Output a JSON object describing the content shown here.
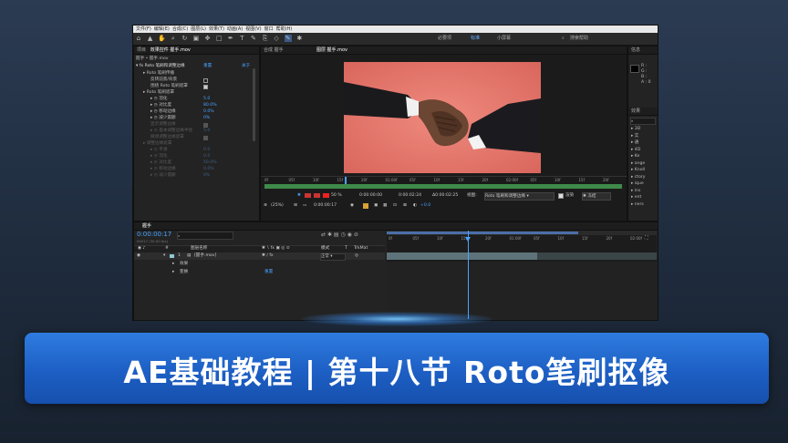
{
  "menu": [
    "文件(F)",
    "编辑(E)",
    "合成(C)",
    "图层(L)",
    "效果(T)",
    "动画(A)",
    "视图(V)",
    "窗口",
    "帮助(H)"
  ],
  "workspaces": [
    "必要项",
    "标准",
    "小屏幕"
  ],
  "search_help": "搜索帮助",
  "project_tab": "项目",
  "effects_controls_tab": "效果控件 握手.mov",
  "comp_tab": "合成 握手",
  "layer_tab": "图层 握手.mov",
  "effects_title": "握手 • 握手.mov",
  "effect": {
    "name": "Roto 笔刷和调整边缘",
    "reset": "重置",
    "about": "关于",
    "rows": [
      {
        "label": "Roto 笔刷传播",
        "type": "group",
        "dim": false
      },
      {
        "label": "反转前景/背景",
        "type": "check",
        "on": false,
        "dim": false
      },
      {
        "label": "围绕 Roto 笔刷遮罩",
        "type": "check",
        "on": true,
        "dim": false
      },
      {
        "label": "Roto 笔刷遮罩",
        "type": "group",
        "dim": false
      },
      {
        "label": "羽化",
        "value": "5.0",
        "dim": false
      },
      {
        "label": "对比度",
        "value": "80.0%",
        "dim": false
      },
      {
        "label": "移动边缘",
        "value": "0.0%",
        "dim": false
      },
      {
        "label": "减少震颤",
        "value": "0%",
        "dim": false
      },
      {
        "label": "显示调整边缘",
        "type": "check",
        "on": true,
        "dim": true
      },
      {
        "label": "基本调整边缘半径",
        "value": "5.0",
        "dim": true
      },
      {
        "label": "微调调整边缘遮罩",
        "type": "check",
        "on": true,
        "dim": true
      },
      {
        "label": "调整边缘遮罩",
        "type": "group",
        "dim": true
      },
      {
        "label": "平滑",
        "value": "0.0",
        "dim": true
      },
      {
        "label": "羽化",
        "value": "0.0",
        "dim": true
      },
      {
        "label": "对比度",
        "value": "50.0%",
        "dim": true
      },
      {
        "label": "移动边缘",
        "value": "0.0%",
        "dim": true
      },
      {
        "label": "减少震颤",
        "value": "0%",
        "dim": true
      }
    ]
  },
  "viewer": {
    "ruler_ticks": [
      "0f",
      "05f",
      "10f",
      "15f",
      "20f",
      "01:00f",
      "05f",
      "10f",
      "15f",
      "20f",
      "02:00f",
      "05f",
      "10f",
      "15f",
      "20f"
    ],
    "zoom_pct": "50 %",
    "time_start": "0:00:00:00",
    "time_end": "0:00:02:24",
    "time_dur": "Δ0:00:02:25",
    "view_label": "视图:",
    "view_value": "Roto 笔刷和调整边缘",
    "render_label": "渲染",
    "freeze_label": "冻结",
    "zoom_bottom": "(25%)",
    "current_time": "0:00:00:17",
    "offset": "+0.0"
  },
  "right_panel": {
    "info_tab": "信息",
    "info_rows": [
      "R :",
      "G :",
      "B :",
      "A : 0"
    ],
    "effects_tab": "效果",
    "effects_list": [
      "▸ 3D",
      "▸ 实",
      "▸ 通",
      "▸ 4D",
      "▸ Ke",
      "▸ ange",
      "▸ Knoll",
      "▸ ctory",
      "▸ ique",
      "▸ ins",
      "▸ ent",
      "▸ ners"
    ]
  },
  "timeline": {
    "tab": "握手",
    "time": "0:00:00:17",
    "frames_info": "00017 (30.00 fps)",
    "columns": [
      "#",
      "图层名称",
      "模式",
      "T",
      "TrkMat"
    ],
    "layer": {
      "index": "1",
      "name": "[握手.mov]",
      "mode": "正常"
    },
    "sub_rows": [
      "效果",
      "变换"
    ],
    "reset": "重置",
    "ruler_ticks": [
      "0f",
      "05f",
      "10f",
      "15f",
      "20f",
      "01:00f",
      "05f",
      "10f",
      "15f",
      "20f",
      "02:00f"
    ]
  },
  "banner": {
    "title": "AE基础教程 | 第十八节  Roto笔刷抠像"
  },
  "colors": {
    "accent": "#2f7ce0",
    "ae_blue": "#4aa3ff",
    "footage_bg": "#e0776d"
  }
}
